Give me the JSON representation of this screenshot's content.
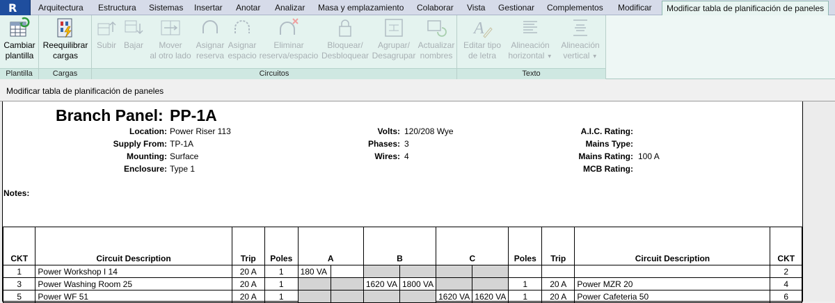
{
  "tabs": [
    {
      "label": "Arquitectura",
      "active": false
    },
    {
      "label": "Estructura",
      "active": false
    },
    {
      "label": "Sistemas",
      "active": false
    },
    {
      "label": "Insertar",
      "active": false
    },
    {
      "label": "Anotar",
      "active": false
    },
    {
      "label": "Analizar",
      "active": false
    },
    {
      "label": "Masa y emplazamiento",
      "active": false
    },
    {
      "label": "Colaborar",
      "active": false
    },
    {
      "label": "Vista",
      "active": false
    },
    {
      "label": "Gestionar",
      "active": false
    },
    {
      "label": "Complementos",
      "active": false
    },
    {
      "label": "Modificar",
      "active": false
    },
    {
      "label": "Modificar tabla de planificación de paneles",
      "active": true
    }
  ],
  "ribbon": {
    "panels": {
      "plantilla": "Plantilla",
      "cargas": "Cargas",
      "circuitos": "Circuitos",
      "texto": "Texto"
    },
    "buttons": {
      "cambiar_plantilla": [
        "Cambiar",
        "plantilla"
      ],
      "reequilibrar": [
        "Reequilibrar",
        "cargas"
      ],
      "subir": [
        "Subir",
        ""
      ],
      "bajar": [
        "Bajar",
        ""
      ],
      "mover": [
        "Mover",
        "al otro lado"
      ],
      "asignar_reserva": [
        "Asignar",
        "reserva"
      ],
      "asignar_espacio": [
        "Asignar",
        "espacio"
      ],
      "eliminar": [
        "Eliminar",
        "reserva/espacio"
      ],
      "bloquear": [
        "Bloquear/",
        "Desbloquear"
      ],
      "agrupar": [
        "Agrupar/",
        "Desagrupar"
      ],
      "actualizar": [
        "Actualizar",
        "nombres"
      ],
      "editar_tipo": [
        "Editar tipo",
        "de letra"
      ],
      "alin_horizontal": [
        "Alineación",
        "horizontal"
      ],
      "alin_vertical": [
        "Alineación",
        "vertical"
      ]
    }
  },
  "options_bar": {
    "label": "Modificar tabla de planificación de paneles"
  },
  "panel": {
    "title_label": "Branch Panel:",
    "name": "PP-1A",
    "left": [
      {
        "label": "Location:",
        "value": "Power Riser 113"
      },
      {
        "label": "Supply From:",
        "value": "TP-1A"
      },
      {
        "label": "Mounting:",
        "value": "Surface"
      },
      {
        "label": "Enclosure:",
        "value": "Type 1"
      }
    ],
    "middle": [
      {
        "label": "Volts:",
        "value": "120/208 Wye"
      },
      {
        "label": "Phases:",
        "value": "3"
      },
      {
        "label": "Wires:",
        "value": "4"
      }
    ],
    "right": [
      {
        "label": "A.I.C. Rating:",
        "value": ""
      },
      {
        "label": "Mains Type:",
        "value": ""
      },
      {
        "label": "Mains Rating:",
        "value": "100 A"
      },
      {
        "label": "MCB Rating:",
        "value": ""
      }
    ],
    "notes_label": "Notes:"
  },
  "circuits": {
    "headers": [
      "CKT",
      "Circuit Description",
      "Trip",
      "Poles",
      "A",
      "B",
      "C",
      "Poles",
      "Trip",
      "Circuit Description",
      "CKT"
    ],
    "rows": [
      {
        "ckt_l": "1",
        "desc_l": "Power Workshop I 14",
        "trip_l": "20 A",
        "poles_l": "1",
        "a1": "180 VA",
        "a2": "",
        "b1": "",
        "b2": "",
        "c1": "",
        "c2": "",
        "poles_r": "",
        "trip_r": "",
        "desc_r": "",
        "ckt_r": "2"
      },
      {
        "ckt_l": "3",
        "desc_l": "Power Washing Room 25",
        "trip_l": "20 A",
        "poles_l": "1",
        "a1": "",
        "a2": "",
        "b1": "1620 VA",
        "b2": "1800 VA",
        "c1": "",
        "c2": "",
        "poles_r": "1",
        "trip_r": "20 A",
        "desc_r": "Power MZR 20",
        "ckt_r": "4"
      },
      {
        "ckt_l": "5",
        "desc_l": "Power WF 51",
        "trip_l": "20 A",
        "poles_l": "1",
        "a1": "",
        "a2": "",
        "b1": "",
        "b2": "",
        "c1": "1620 VA",
        "c2": "1620 VA",
        "poles_r": "1",
        "trip_r": "20 A",
        "desc_r": "Power Cafeteria 50",
        "ckt_r": "6"
      }
    ]
  }
}
